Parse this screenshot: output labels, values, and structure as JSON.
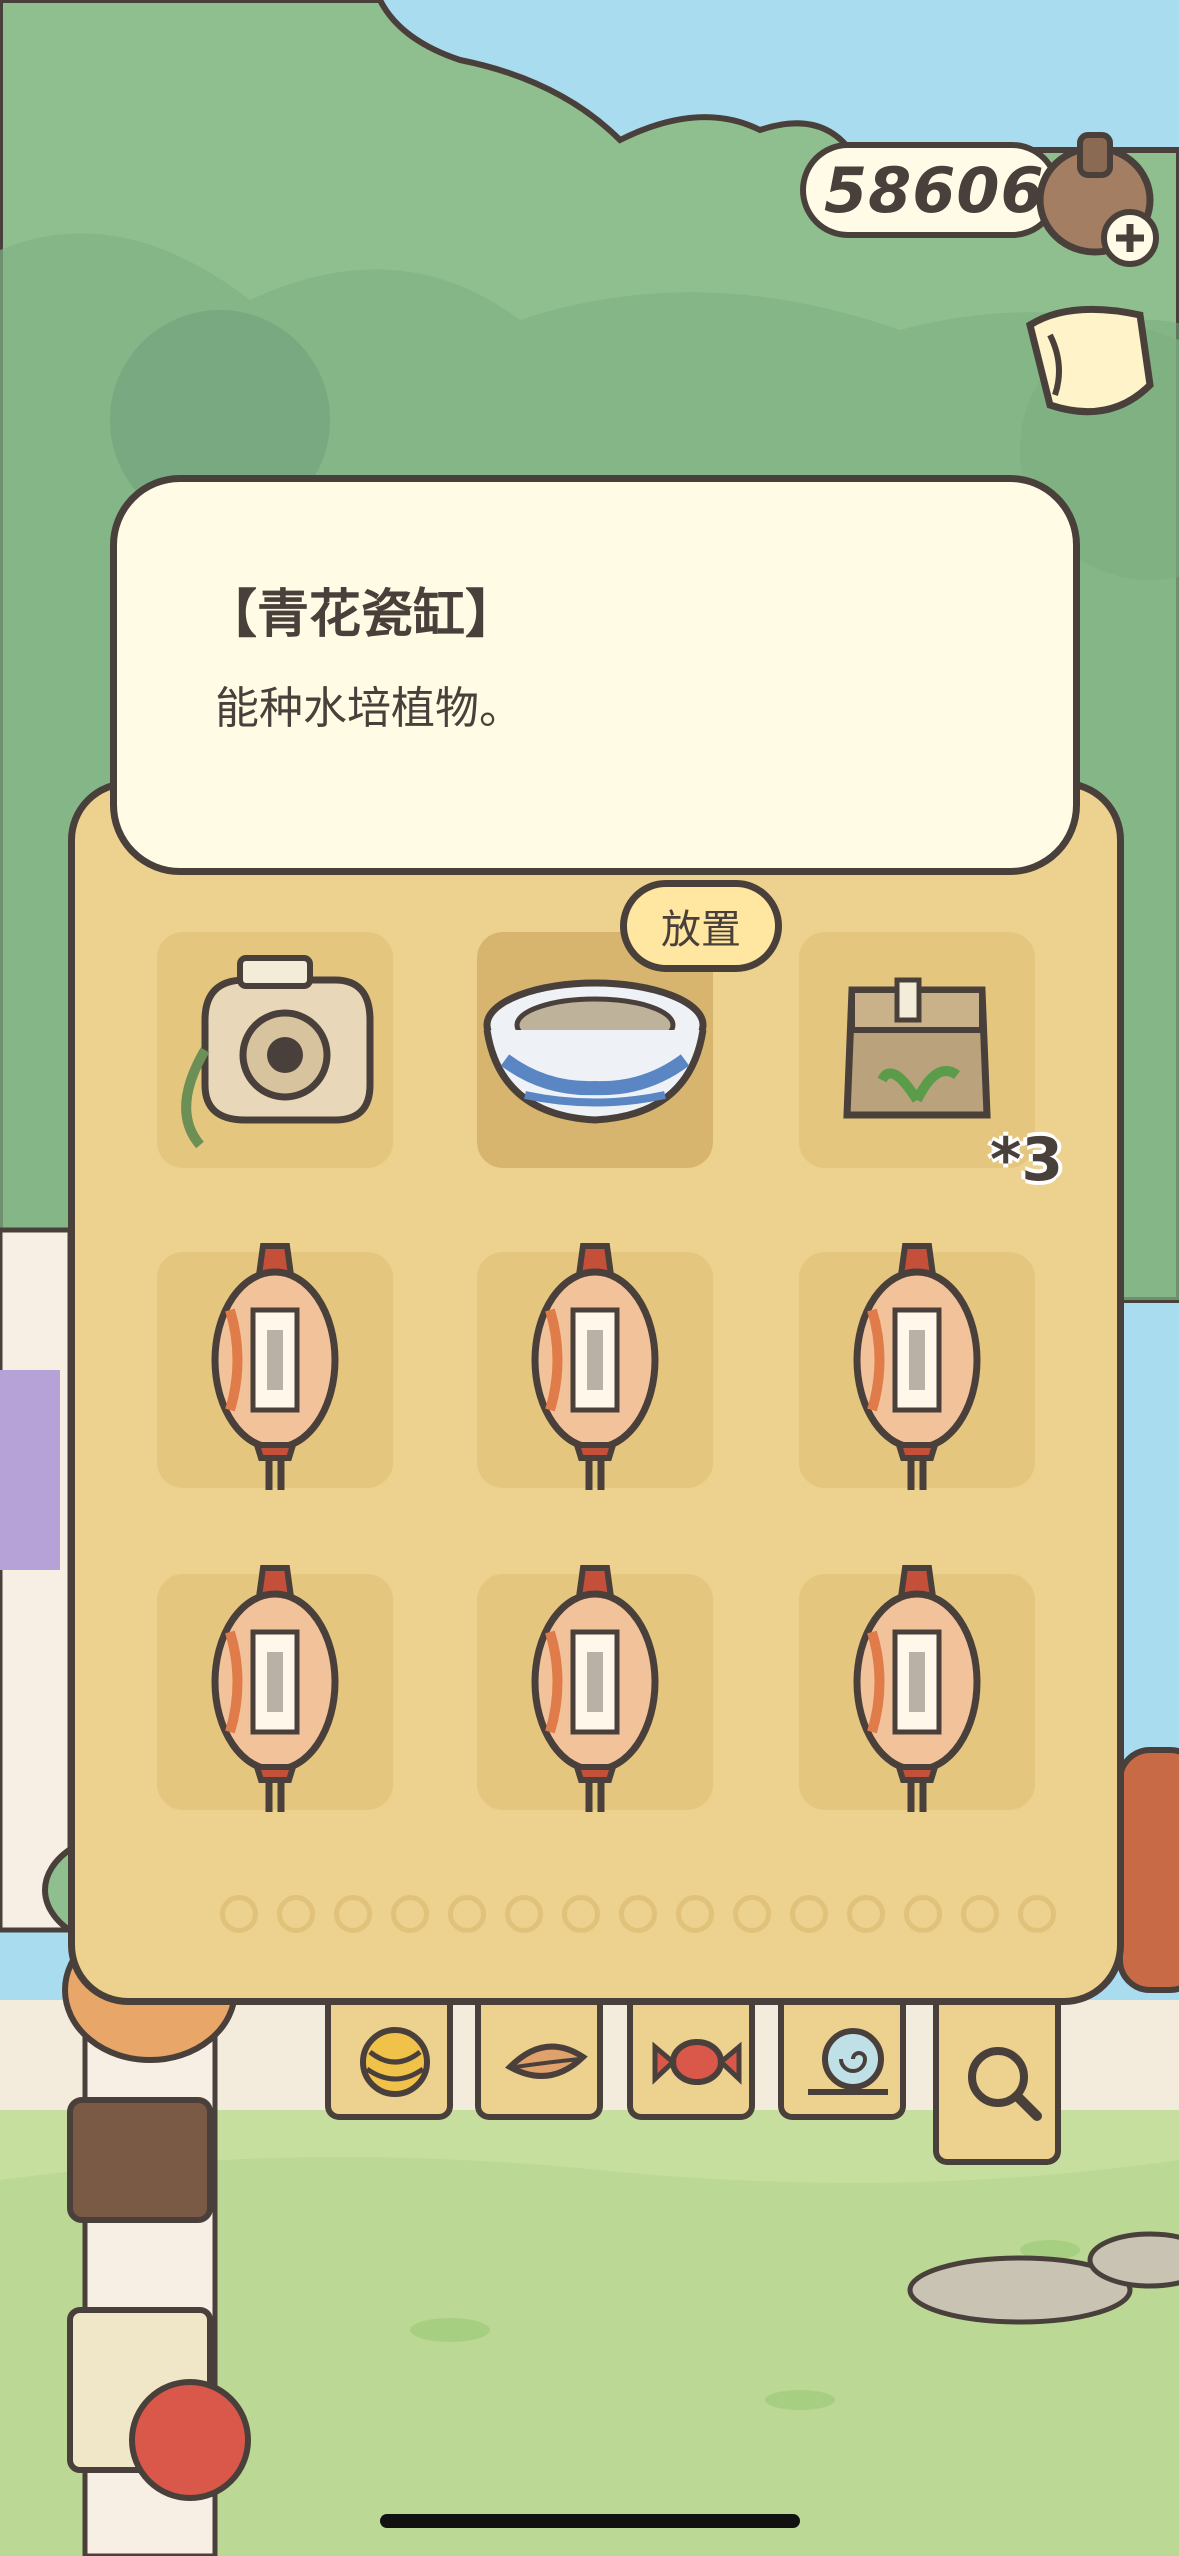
{
  "currency": {
    "value": "586065",
    "icon": "acorn-plus-icon"
  },
  "item_detail": {
    "title": "【青花瓷缸】",
    "description": "能种水培植物。"
  },
  "inventory": {
    "place_label": "放置",
    "selected_item": "blue-white-porcelain-vat",
    "items": [
      {
        "name": "camera",
        "icon": "camera-icon"
      },
      {
        "name": "blue-white-porcelain-vat",
        "icon": "porcelain-bowl-icon"
      },
      {
        "name": "seed-bag",
        "icon": "seed-bag-icon",
        "count": "*3"
      },
      {
        "name": "lantern",
        "icon": "lantern-icon"
      },
      {
        "name": "lantern",
        "icon": "lantern-icon"
      },
      {
        "name": "lantern",
        "icon": "lantern-icon"
      },
      {
        "name": "lantern",
        "icon": "lantern-icon"
      },
      {
        "name": "lantern",
        "icon": "lantern-icon"
      },
      {
        "name": "lantern",
        "icon": "lantern-icon"
      }
    ],
    "page_dot_count": 15
  },
  "tabs": [
    {
      "name": "yarn",
      "icon": "yarn-ball-icon"
    },
    {
      "name": "leaf",
      "icon": "leaf-icon"
    },
    {
      "name": "candy",
      "icon": "candy-icon"
    },
    {
      "name": "snail",
      "icon": "snail-icon"
    },
    {
      "name": "search",
      "icon": "magnifier-icon",
      "active": true
    }
  ],
  "colors": {
    "outline": "#4a403b",
    "panel": "#ecd18f",
    "card": "#fffbe4",
    "sky": "#a9dcef",
    "foliage": "#8fbf8e"
  }
}
